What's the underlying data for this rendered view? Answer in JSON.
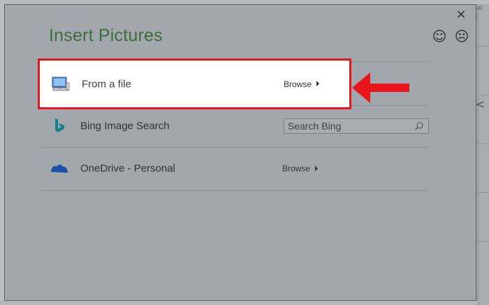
{
  "dialog": {
    "title": "Insert Pictures",
    "close_glyph": "×",
    "smile_glyph": "☺",
    "frown_glyph": "☹"
  },
  "sources": [
    {
      "icon": "computer-icon",
      "label": "From a file",
      "action": "Browse"
    },
    {
      "icon": "bing-icon",
      "label": "Bing Image Search",
      "search_placeholder": "Search Bing"
    },
    {
      "icon": "onedrive-icon",
      "label": "OneDrive - Personal",
      "action": "Browse"
    }
  ],
  "background": {
    "right_text": "nal\ng",
    "chevron": "<"
  },
  "colors": {
    "title_green": "#3e6e3c",
    "highlight_red": "#e8161c",
    "bing_teal": "#137f86",
    "onedrive_blue": "#1b4fa8"
  }
}
